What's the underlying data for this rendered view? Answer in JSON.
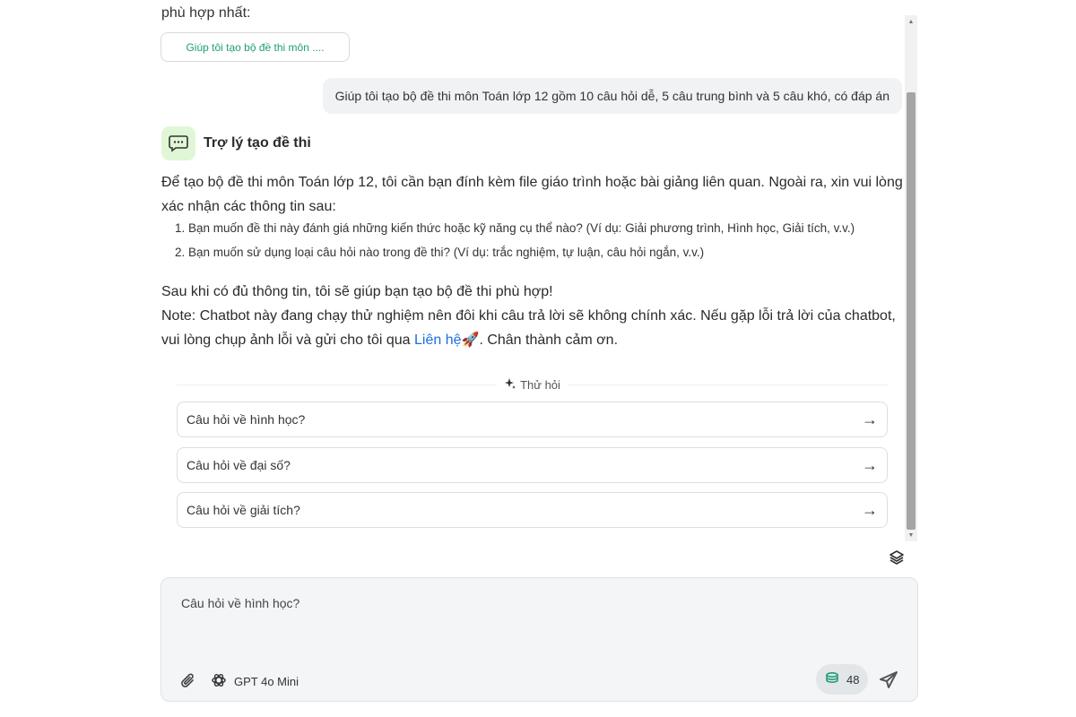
{
  "chat": {
    "previous_text": "phù hợp nhất:",
    "suggestion_pill": "Giúp tôi tạo bộ đề thi môn ....",
    "user_message": "Giúp tôi tạo bộ đề thi môn Toán lớp 12 gồm 10 câu hỏi dễ, 5 câu trung bình và 5 câu khó, có đáp án",
    "assistant": {
      "name": "Trợ lý tạo đề thi",
      "avatar_icon": "chat-bubble-icon",
      "avatar_bg": "#dff7d6",
      "intro": "Để tạo bộ đề thi môn Toán lớp 12, tôi cần bạn đính kèm file giáo trình hoặc bài giảng liên quan. Ngoài ra, xin vui lòng xác nhận các thông tin sau:",
      "list": [
        "Bạn muốn đề thi này đánh giá những kiến thức hoặc kỹ năng cụ thể nào? (Ví dụ: Giải phương trình, Hình học, Giải tích, v.v.)",
        "Bạn muốn sử dụng loại câu hỏi nào trong đề thi? (Ví dụ: trắc nghiệm, tự luận, câu hỏi ngắn, v.v.)"
      ],
      "outro": "Sau khi có đủ thông tin, tôi sẽ giúp bạn tạo bộ đề thi phù hợp!",
      "note_prefix": "Note: Chatbot này đang chạy thử nghiệm nên đôi khi câu trả lời sẽ không chính xác. Nếu gặp lỗi trả lời của chatbot, vui lòng chụp ảnh lỗi và gửi cho tôi qua ",
      "note_link": "Liên hệ",
      "note_suffix": ". Chân thành cảm ơn."
    },
    "try_label": "Thử hỏi",
    "suggested_questions": [
      "Câu hỏi về hình học?",
      "Câu hỏi về đại số?",
      "Câu hỏi về giải tích?"
    ]
  },
  "composer": {
    "input_value": "Câu hỏi về hình học?",
    "model_label": "GPT 4o Mini",
    "credits": "48"
  },
  "colors": {
    "accent_green": "#1f9d7a",
    "link_blue": "#1a6fe0"
  }
}
